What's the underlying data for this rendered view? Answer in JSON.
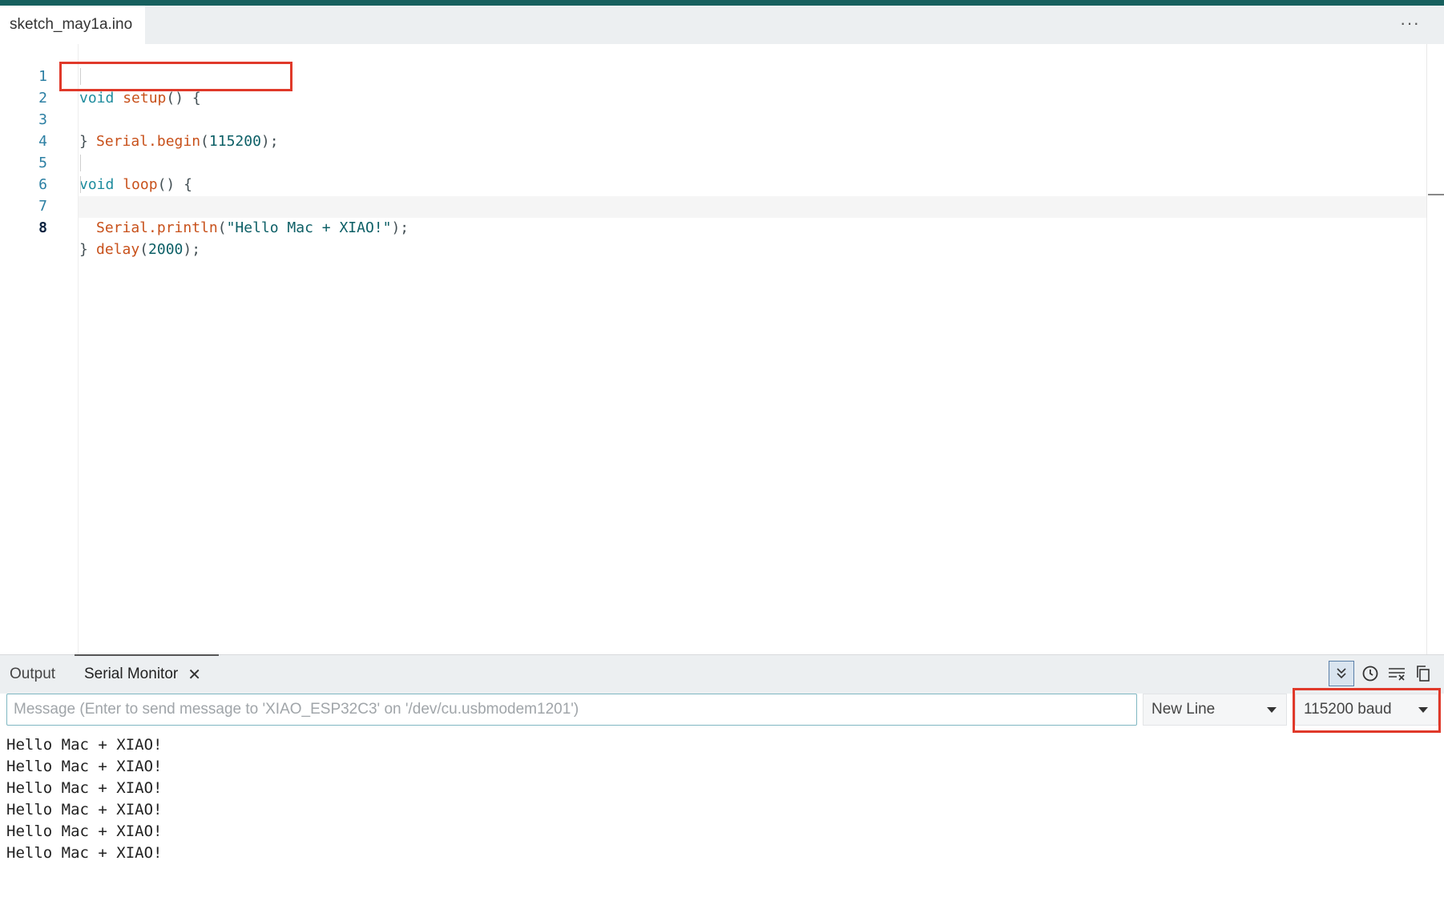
{
  "editor": {
    "file_tab": "sketch_may1a.ino",
    "lines": [
      {
        "n": "1",
        "kw": "void",
        "sp": " ",
        "fn": "setup",
        "rest": "() {"
      },
      {
        "n": "2",
        "fn": "Serial.begin",
        "rest": "(",
        "num": "115200",
        "end": ");"
      },
      {
        "n": "3",
        "rest": "}"
      },
      {
        "n": "4"
      },
      {
        "n": "5",
        "kw": "void",
        "sp": " ",
        "fn": "loop",
        "rest": "() {"
      },
      {
        "n": "6",
        "fn": "Serial.println",
        "rest": "(",
        "str": "\"Hello Mac + XIAO!\"",
        "end": ");"
      },
      {
        "n": "7",
        "fn": "delay",
        "rest": "(",
        "num": "2000",
        "end": ");"
      },
      {
        "n": "8",
        "rest": "}"
      }
    ]
  },
  "panel": {
    "tabs": {
      "output": "Output",
      "serial_monitor": "Serial Monitor"
    },
    "close_glyph": "✕",
    "message_placeholder": "Message (Enter to send message to 'XIAO_ESP32C3' on '/dev/cu.usbmodem1201')",
    "line_ending": "New Line",
    "baud_rate": "115200 baud",
    "output_lines": [
      "Hello Mac + XIAO!",
      "Hello Mac + XIAO!",
      "Hello Mac + XIAO!",
      "Hello Mac + XIAO!",
      "Hello Mac + XIAO!",
      "Hello Mac + XIAO!"
    ]
  },
  "icons": [
    "more-icon",
    "autoscroll-icon",
    "timestamp-icon",
    "clear-output-icon",
    "copy-icon",
    "close-icon",
    "chevron-down-icon"
  ],
  "colors": {
    "topbar": "#17605e",
    "highlight": "#e0392a",
    "keyword": "#1e8c9e",
    "function": "#c8511b",
    "number": "#0c5f66"
  }
}
